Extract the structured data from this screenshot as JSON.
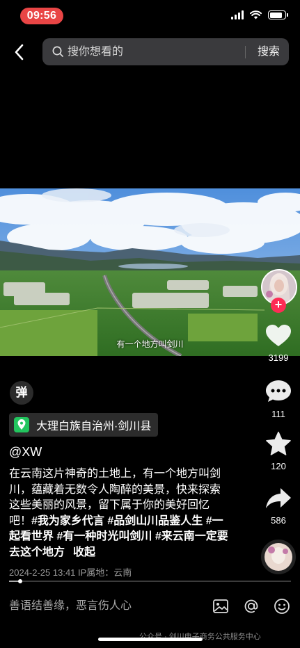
{
  "status_bar": {
    "time": "09:56",
    "battery_level": 0.85,
    "time_pill_color": "#e94545"
  },
  "top_bar": {
    "search_placeholder": "搜你想看的",
    "search_button": "搜索"
  },
  "video": {
    "subtitle": "有一个地方叫剑川",
    "progress": 0.04
  },
  "actions": {
    "like_count": "3199",
    "comment_count": "111",
    "favorite_count": "120",
    "share_count": "586"
  },
  "danmaku_label": "弹",
  "location": "大理白族自治州·剑川县",
  "author": "@XW",
  "description": {
    "text": "在云南这片神奇的土地上，有一个地方叫剑川，蕴藏着无数令人陶醉的美景，快来探索这些美丽的风景，留下属于你的美好回忆吧！",
    "tags": [
      "#我为家乡代言",
      "#品剑山川品鉴人生",
      "#一起看世界",
      "#有一种时光叫剑川",
      "#来云南一定要去这个地方"
    ],
    "collapse": "收起"
  },
  "meta": "2024-2-25 13:41  IP属地：云南",
  "comment_bar": {
    "placeholder": "善语结善缘，恶言伤人心"
  },
  "watermark": "公众号 · 剑川电子商务公共服务中心",
  "colors": {
    "follow": "#fe2c55",
    "location_icon": "#22c55e",
    "search_bg": "#3a3a3d"
  },
  "icons": [
    "back-icon",
    "search-icon",
    "heart-icon",
    "comment-icon",
    "star-icon",
    "share-icon",
    "image-icon",
    "at-icon",
    "emoji-icon",
    "location-pin-icon"
  ]
}
